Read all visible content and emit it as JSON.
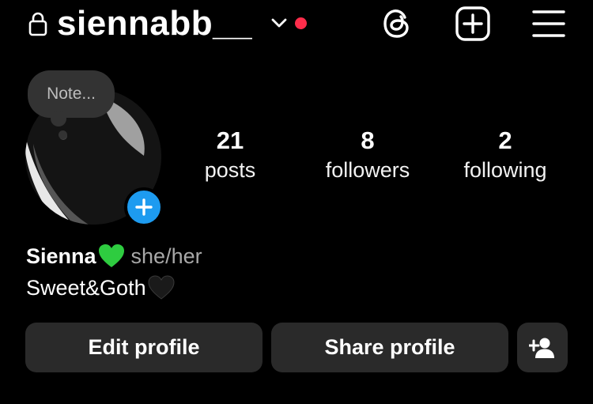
{
  "header": {
    "username": "siennabb__",
    "icons": [
      "lock-icon",
      "chevron-down-icon",
      "threads-icon",
      "new-post-icon",
      "menu-icon"
    ],
    "notification_color": "#ff2d4b"
  },
  "profile": {
    "note_label": "Note...",
    "stats": {
      "posts_count": "21",
      "posts_label": "posts",
      "followers_count": "8",
      "followers_label": "followers",
      "following_count": "2",
      "following_label": "following"
    },
    "name": "Sienna",
    "pronouns": "she/her",
    "bio": "Sweet&Goth"
  },
  "actions": {
    "edit_label": "Edit profile",
    "share_label": "Share profile"
  },
  "colors": {
    "background": "#000000",
    "button": "#2a2a2a",
    "accent_blue": "#1d9bf0",
    "green_heart": "#2ecc40",
    "black_heart": "#1a1a1a"
  }
}
